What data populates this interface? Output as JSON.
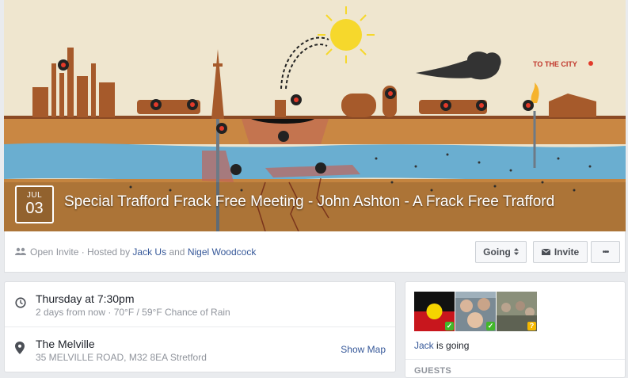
{
  "event": {
    "month": "JUL",
    "day": "03",
    "title": "Special Trafford Frack Free Meeting - John Ashton - A Frack Free Trafford",
    "cover_caption": "TO THE CITY"
  },
  "host": {
    "privacy": "Open Invite",
    "hosted_by": "· Hosted by",
    "host1": "Jack Us",
    "and": "and",
    "host2": "Nigel Woodcock"
  },
  "actions": {
    "going_label": "Going",
    "invite_label": "Invite",
    "more_label": "•••"
  },
  "details": {
    "time_main": "Thursday at 7:30pm",
    "time_sub": "2 days from now · 70°F / 59°F Chance of Rain",
    "place_main": "The Melville",
    "place_sub": "35 MELVILLE ROAD, M32 8EA Stretford",
    "show_map": "Show Map"
  },
  "guests": {
    "going_name": "Jack",
    "going_text": "is going",
    "label": "GUESTS",
    "badges": [
      "✓",
      "✓",
      "?"
    ]
  },
  "icons": {
    "people": "people-icon",
    "clock": "clock-icon",
    "pin": "map-pin-icon",
    "envelope": "envelope-icon",
    "updown": "updown-caret-icon"
  },
  "colors": {
    "link": "#365899",
    "check": "#42b72a",
    "question": "#f5b800",
    "soil": "#b8733a",
    "water": "#6aaed0"
  }
}
